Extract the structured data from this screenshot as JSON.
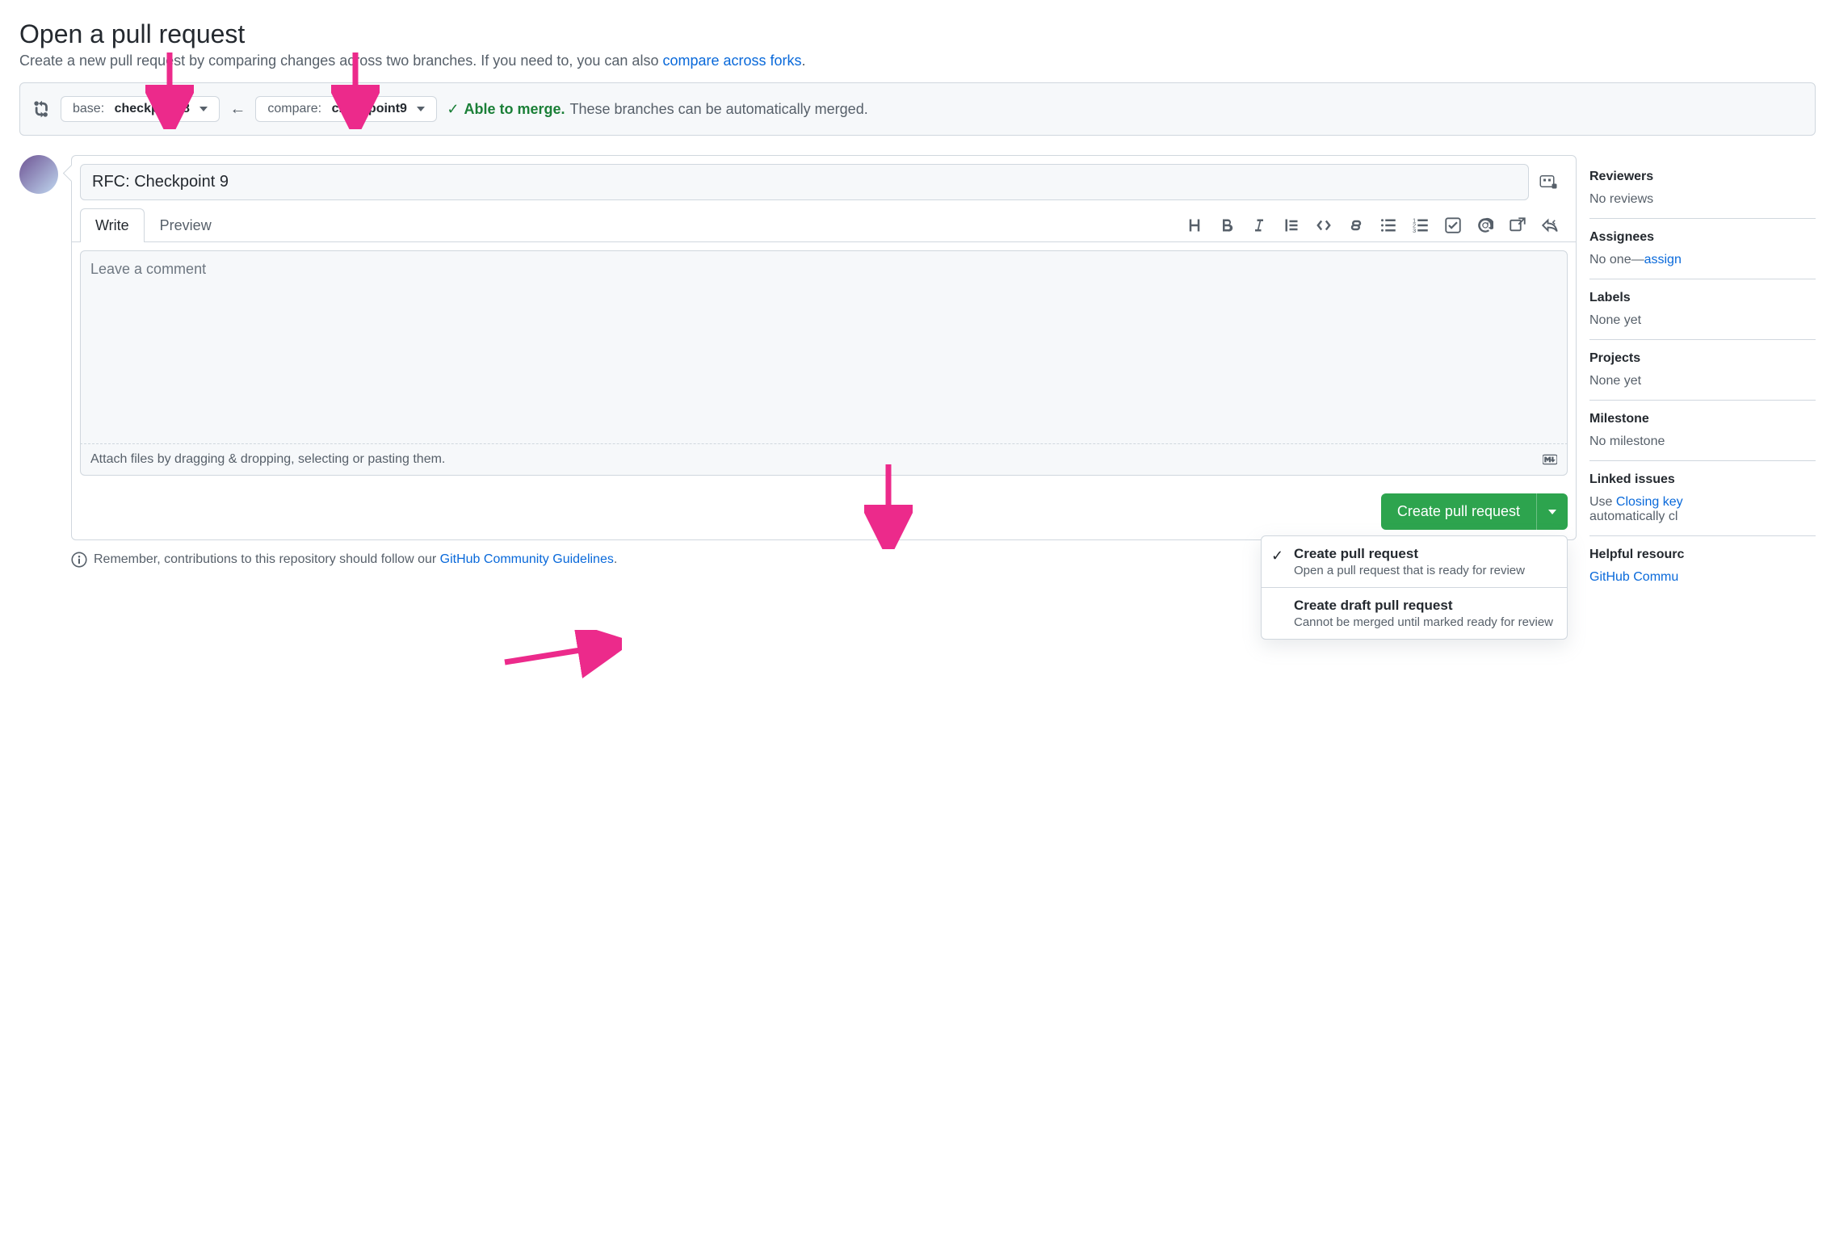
{
  "header": {
    "title": "Open a pull request",
    "subtitle_pre": "Create a new pull request by comparing changes across two branches. If you need to, you can also ",
    "subtitle_link": "compare across forks",
    "subtitle_post": "."
  },
  "branch": {
    "base_label": "base:",
    "base_value": "checkpoint8",
    "compare_label": "compare:",
    "compare_value": "checkpoint9",
    "able_label": "Able to merge.",
    "able_rest": "These branches can be automatically merged."
  },
  "pr": {
    "title_value": "RFC: Checkpoint 9",
    "tab_write": "Write",
    "tab_preview": "Preview",
    "comment_placeholder": "Leave a comment",
    "attach_text": "Attach files by dragging & dropping, selecting or pasting them.",
    "create_label": "Create pull request"
  },
  "dropdown": {
    "opt1_title": "Create pull request",
    "opt1_desc": "Open a pull request that is ready for review",
    "opt2_title": "Create draft pull request",
    "opt2_desc": "Cannot be merged until marked ready for review"
  },
  "guidelines": {
    "pre": "Remember, contributions to this repository should follow our ",
    "link": "GitHub Community Guidelines",
    "post": "."
  },
  "sidebar": {
    "reviewers_title": "Reviewers",
    "reviewers_content": "No reviews",
    "assignees_title": "Assignees",
    "assignees_content_pre": "No one—",
    "assignees_link": "assign",
    "labels_title": "Labels",
    "labels_content": "None yet",
    "projects_title": "Projects",
    "projects_content": "None yet",
    "milestone_title": "Milestone",
    "milestone_content": "No milestone",
    "linked_title": "Linked issues",
    "linked_pre": "Use ",
    "linked_link": "Closing key",
    "linked_post": " automatically cl",
    "helpful_title": "Helpful resourc",
    "helpful_link": "GitHub Commu"
  }
}
